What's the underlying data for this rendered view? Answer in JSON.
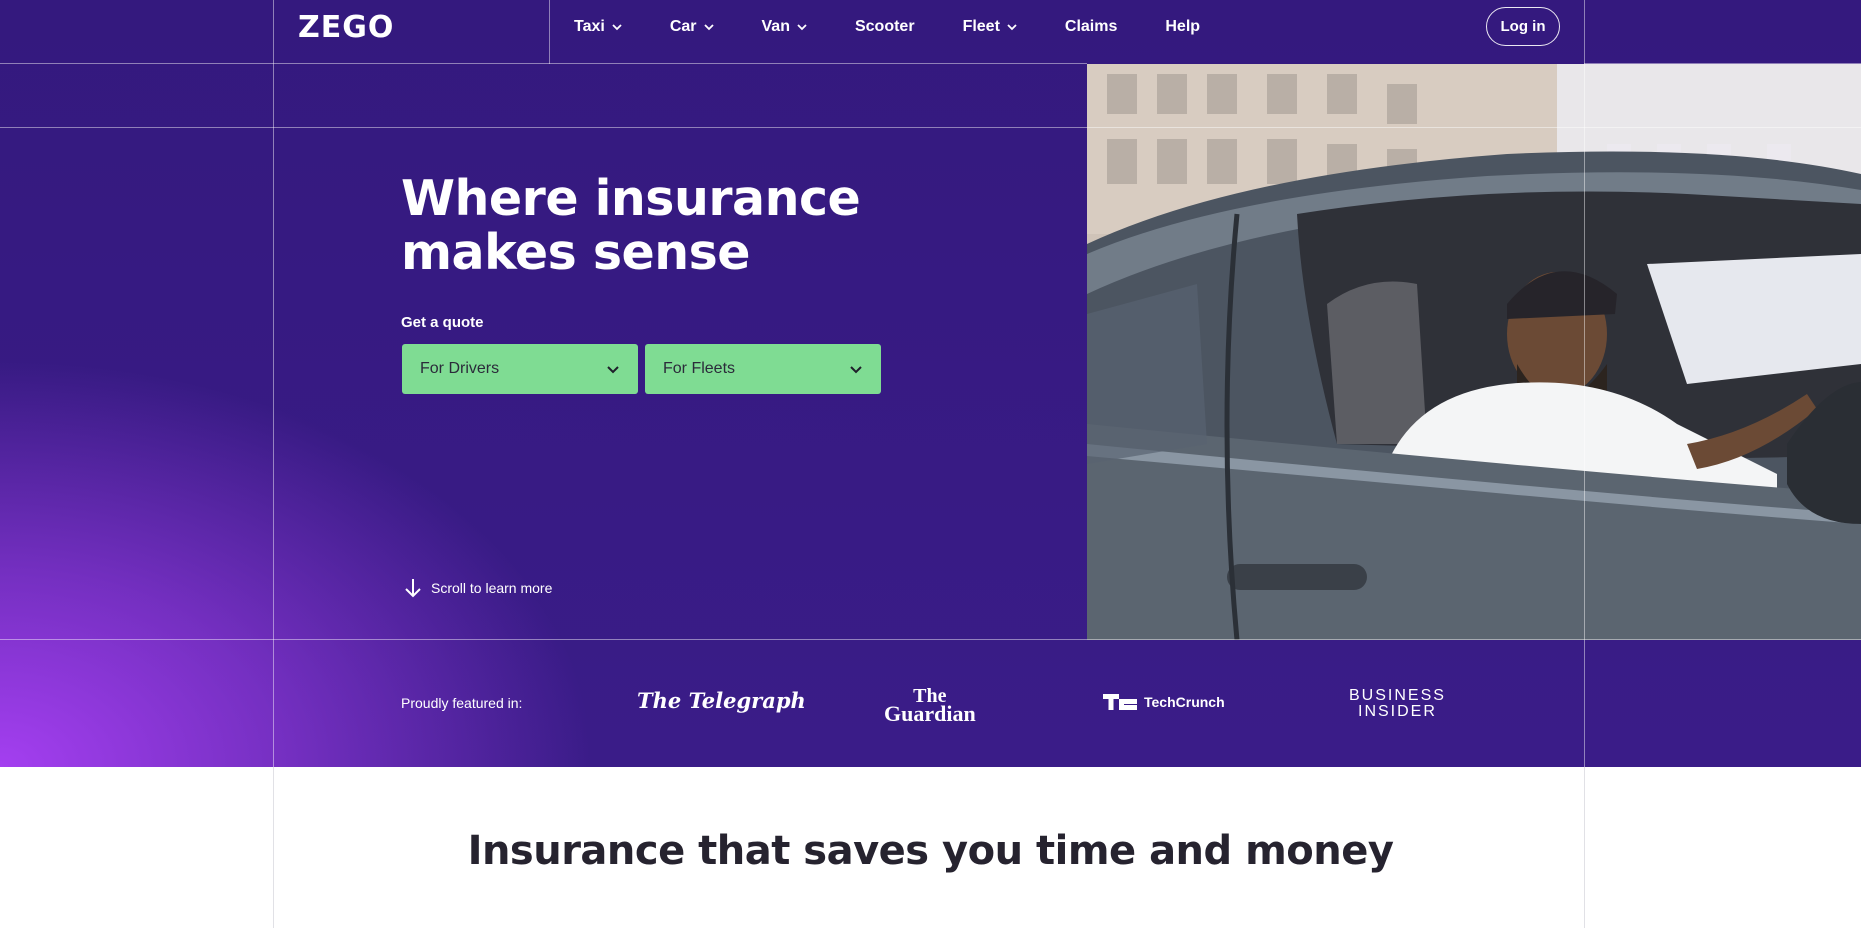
{
  "header": {
    "logo": "ZEGO",
    "nav": [
      {
        "label": "Taxi",
        "dropdown": true
      },
      {
        "label": "Car",
        "dropdown": true
      },
      {
        "label": "Van",
        "dropdown": true
      },
      {
        "label": "Scooter",
        "dropdown": false
      },
      {
        "label": "Fleet",
        "dropdown": true
      },
      {
        "label": "Claims",
        "dropdown": false
      },
      {
        "label": "Help",
        "dropdown": false
      }
    ],
    "login_label": "Log in"
  },
  "hero": {
    "title_line1": "Where insurance",
    "title_line2": "makes sense",
    "quote_label": "Get a quote",
    "quote_options": [
      "For Drivers",
      "For Fleets"
    ],
    "scroll_label": "Scroll to learn more"
  },
  "featured": {
    "label": "Proudly featured in:",
    "telegraph": "The Telegraph",
    "guardian_line1": "The",
    "guardian_line2": "Guardian",
    "techcrunch": "TechCrunch",
    "bi_line1": "BUSINESS",
    "bi_line2": "INSIDER"
  },
  "section": {
    "title": "Insurance that saves you time and money"
  },
  "colors": {
    "purple": "#34197e",
    "purple_glow": "#a43ff0",
    "quote_green": "#7fdc93",
    "heading_dark": "#26232f"
  },
  "icons": {
    "nav_dropdown": "chevron-down-icon",
    "quote_dropdown": "chevron-down-icon",
    "scroll": "arrow-down-icon"
  }
}
